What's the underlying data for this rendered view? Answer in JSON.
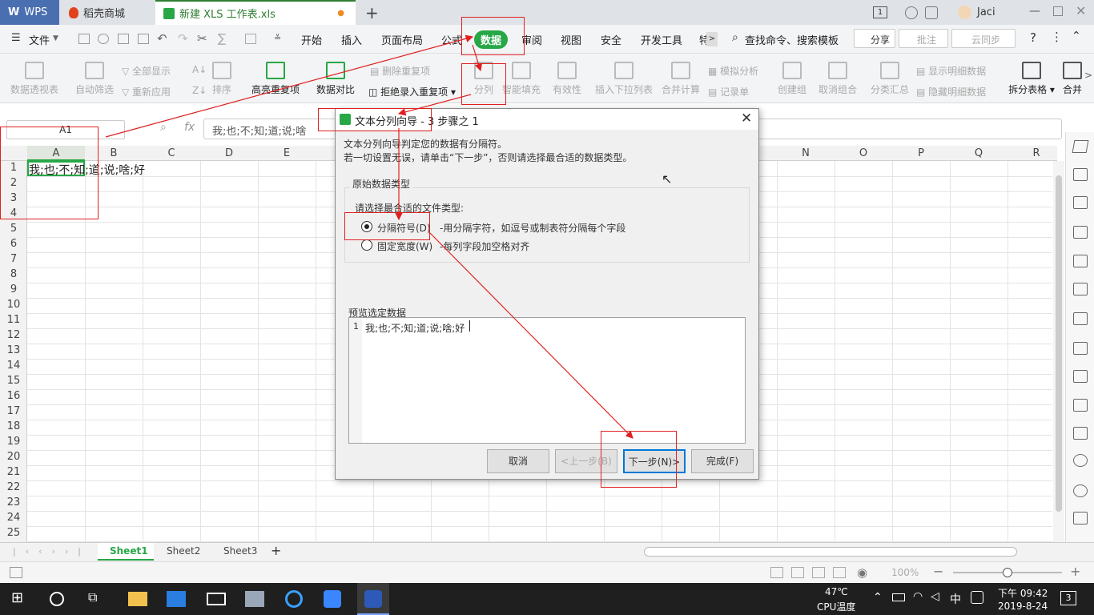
{
  "tabs": {
    "wps": "WPS",
    "store": "稻壳商城",
    "doc": "新建 XLS 工作表.xls",
    "add": "+"
  },
  "window": {
    "page_num": "1",
    "user": "Jaci"
  },
  "menu": {
    "file": "文件",
    "items": [
      "开始",
      "插入",
      "页面布局",
      "公式",
      "数据",
      "审阅",
      "视图",
      "安全",
      "开发工具",
      "特"
    ],
    "search": "查找命令、搜索模板",
    "share": "分享",
    "comment": "批注",
    "sync": "云同步",
    "help": "?"
  },
  "ribbon": {
    "pivot": "数据透视表",
    "autofilter": "自动筛选",
    "showall": "全部显示",
    "reapply": "重新应用",
    "sort": "排序",
    "highlight_dup": "高亮重复项",
    "compare": "数据对比",
    "delete_dup": "删除重复项",
    "reject_dup": "拒绝录入重复项",
    "split": "分列",
    "smartfill": "智能填充",
    "validity": "有效性",
    "dropdown": "插入下拉列表",
    "consolidate": "合并计算",
    "whatif": "模拟分析",
    "record": "记录单",
    "group": "创建组",
    "ungroup": "取消组合",
    "subtotal": "分类汇总",
    "show_detail": "显示明细数据",
    "hide_detail": "隐藏明细数据",
    "split_table": "拆分表格",
    "merge": "合并"
  },
  "formula": {
    "namebox": "A1",
    "fx": "fx",
    "content": "我;也;不;知;道;说;啥"
  },
  "grid": {
    "columns": [
      "A",
      "B",
      "C",
      "D",
      "E",
      "N",
      "O",
      "P",
      "Q",
      "R"
    ],
    "rows": [
      "1",
      "2",
      "3",
      "4",
      "5",
      "6",
      "7",
      "8",
      "9",
      "10",
      "11",
      "12",
      "13",
      "14",
      "15",
      "16",
      "17",
      "18",
      "19",
      "20",
      "21",
      "22",
      "23",
      "24",
      "25"
    ],
    "a1_value": "我;也;不;知;道;说;啥;好"
  },
  "dialog": {
    "title": "文本分列向导 - 3 步骤之 1",
    "line1": "文本分列向导判定您的数据有分隔符。",
    "line2": "若一切设置无误，请单击“下一步”，否则请选择最合适的数据类型。",
    "group_title": "原始数据类型",
    "prompt": "请选择最合适的文件类型:",
    "opt1_label": "分隔符号(D)",
    "opt1_desc": "-用分隔字符，如逗号或制表符分隔每个字段",
    "opt2_label": "固定宽度(W)",
    "opt2_desc": "-每列字段加空格对齐",
    "preview_title": "预览选定数据",
    "preview_row_num": "1",
    "preview_row": "我;也;不;知;道;说;啥;好",
    "cancel": "取消",
    "back": "<上一步(B)",
    "next": "下一步(N)>",
    "finish": "完成(F)"
  },
  "sheets": {
    "tabs": [
      "Sheet1",
      "Sheet2",
      "Sheet3"
    ],
    "add": "+"
  },
  "status": {
    "zoom": "100%"
  },
  "taskbar": {
    "temp": "47℃",
    "temp_label": "CPU温度",
    "ime": "中",
    "time": "下午 09:42",
    "date": "2019-8-24",
    "notif": "3"
  },
  "colors": {
    "accent": "#27a745",
    "annotation": "#e02020",
    "taskbar": "#1f1f1f"
  }
}
